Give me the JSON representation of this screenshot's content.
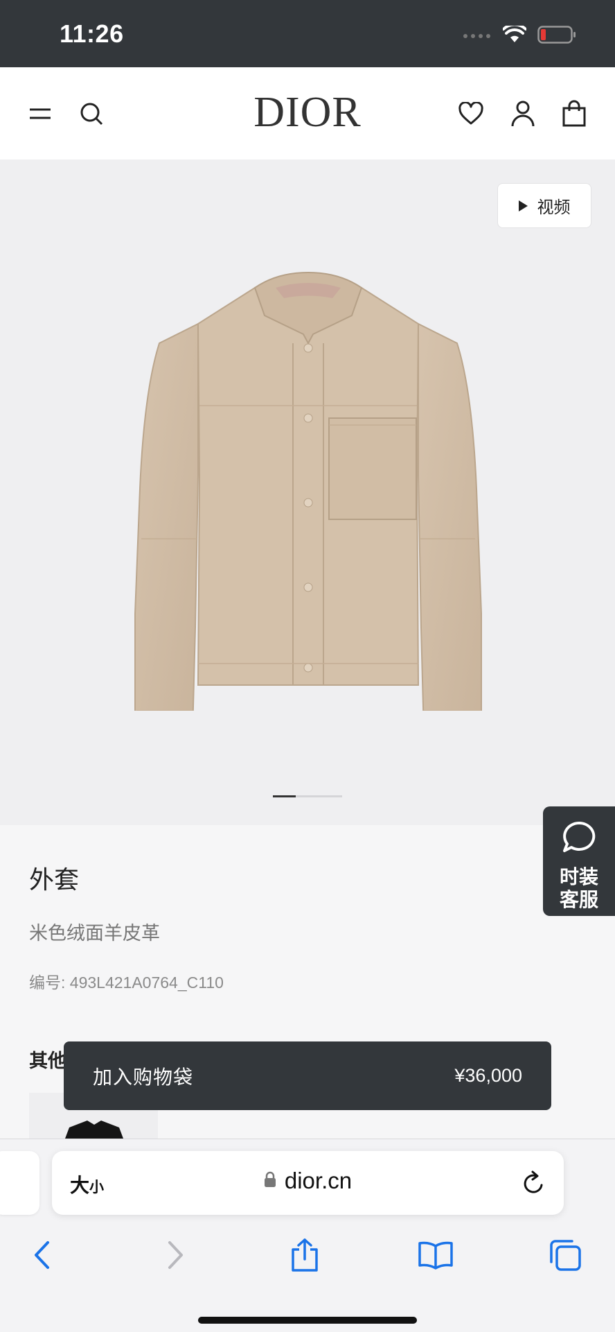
{
  "status_bar": {
    "time": "11:26"
  },
  "header": {
    "brand": "DIOR",
    "icons": [
      "menu-icon",
      "search-icon",
      "heart-icon",
      "account-icon",
      "shopping-bag-icon"
    ]
  },
  "gallery": {
    "video_label": "视频",
    "image_alt": "beige suede jacket",
    "pager_position": 0.33
  },
  "chat": {
    "label_line1": "时装",
    "label_line2": "客服"
  },
  "product": {
    "title": "外套",
    "material": "米色绒面羊皮革",
    "ref_label": "编号: ",
    "ref_value": "493L421A0764_C110",
    "other_heading": "其他"
  },
  "cta": {
    "label": "加入购物袋",
    "price": "¥36,000"
  },
  "browser": {
    "text_size_big": "大",
    "text_size_small": "小",
    "url": "dior.cn"
  },
  "colors": {
    "dark": "#33373b",
    "accent": "#1a73e8",
    "battery_low": "#e53935"
  }
}
